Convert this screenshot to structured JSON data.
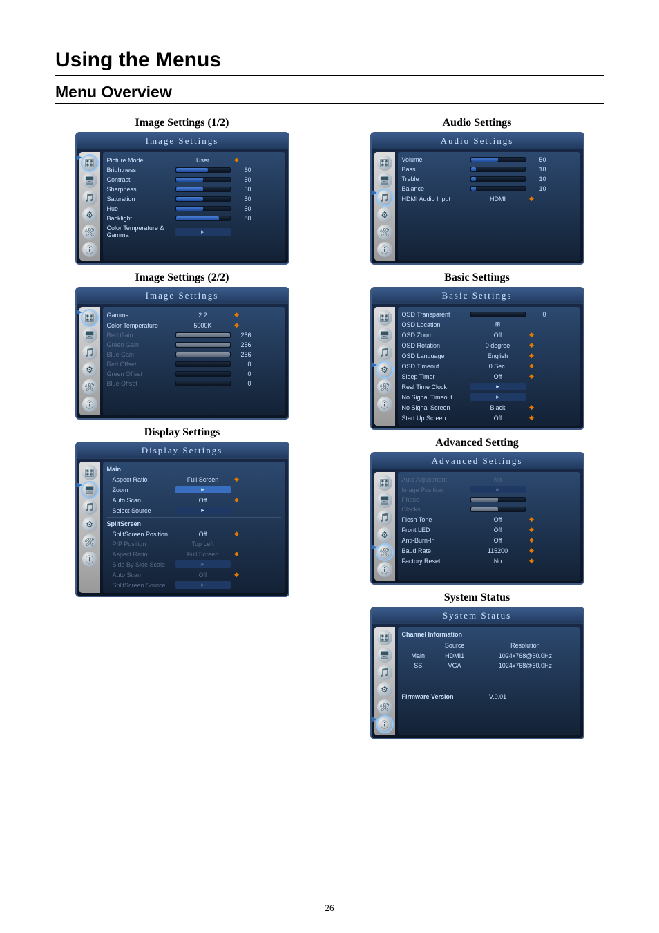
{
  "page_number": "26",
  "title": "Using the Menus",
  "subtitle": "Menu Overview",
  "panels": {
    "image1": {
      "title": "Image Settings (1/2)",
      "osd_title": "Image Settings",
      "rows": [
        {
          "label": "Picture Mode",
          "value": "User",
          "ind": "◆"
        },
        {
          "label": "Brightness",
          "slider": 60,
          "num": "60"
        },
        {
          "label": "Contrast",
          "slider": 50,
          "num": "50"
        },
        {
          "label": "Sharpness",
          "slider": 50,
          "num": "50"
        },
        {
          "label": "Saturation",
          "slider": 50,
          "num": "50"
        },
        {
          "label": "Hue",
          "slider": 50,
          "num": "50"
        },
        {
          "label": "Backlight",
          "slider": 80,
          "num": "80"
        },
        {
          "label": "Color Temperature & Gamma",
          "submenu": "▸"
        }
      ]
    },
    "image2": {
      "title": "Image Settings (2/2)",
      "osd_title": "Image Settings",
      "rows": [
        {
          "label": "Gamma",
          "value": "2.2",
          "ind": "◆"
        },
        {
          "label": "Color Temperature",
          "value": "5000K",
          "ind": "◆"
        },
        {
          "label": "Red Gain",
          "slider": 100,
          "gray": true,
          "dim": true,
          "num": "256"
        },
        {
          "label": "Green Gain",
          "slider": 100,
          "gray": true,
          "dim": true,
          "num": "256"
        },
        {
          "label": "Blue Gain",
          "slider": 100,
          "gray": true,
          "dim": true,
          "num": "256"
        },
        {
          "label": "Red Offset",
          "slider": 0,
          "gray": true,
          "dim": true,
          "num": "0"
        },
        {
          "label": "Green Offset",
          "slider": 0,
          "gray": true,
          "dim": true,
          "num": "0"
        },
        {
          "label": "Blue Offset",
          "slider": 0,
          "gray": true,
          "dim": true,
          "num": "0"
        }
      ]
    },
    "display": {
      "title": "Display Settings",
      "osd_title": "Display Settings",
      "section_main": "Main",
      "main_rows": [
        {
          "label": "Aspect Ratio",
          "value": "Full Screen",
          "ind": "◆"
        },
        {
          "label": "Zoom",
          "submenu": "▸",
          "hl": true
        },
        {
          "label": "Auto Scan",
          "value": "Off",
          "ind": "◆"
        },
        {
          "label": "Select Source",
          "submenu": "▸"
        }
      ],
      "section_split": "SplitScreen",
      "split_rows": [
        {
          "label": "SplitScreen Position",
          "value": "Off",
          "ind": "◆"
        },
        {
          "label": "PIP Position",
          "value": "Top Left",
          "dim": true
        },
        {
          "label": "Aspect Ratio",
          "value": "Full Screen",
          "ind": "◆",
          "dim": true
        },
        {
          "label": "Side By Side Scale",
          "submenu": "▸",
          "dim": true
        },
        {
          "label": "Auto Scan",
          "value": "Off",
          "ind": "◆",
          "dim": true
        },
        {
          "label": "SplitScreen Source",
          "submenu": "▸",
          "dim": true
        }
      ]
    },
    "audio": {
      "title": "Audio Settings",
      "osd_title": "Audio Settings",
      "rows": [
        {
          "label": "Volume",
          "slider": 50,
          "num": "50"
        },
        {
          "label": "Bass",
          "slider": 10,
          "num": "10"
        },
        {
          "label": "Treble",
          "slider": 10,
          "num": "10"
        },
        {
          "label": "Balance",
          "slider": 10,
          "num": "10"
        },
        {
          "label": "HDMI Audio Input",
          "value": "HDMI",
          "ind": "◆"
        }
      ]
    },
    "basic": {
      "title": "Basic Settings",
      "osd_title": "Basic Settings",
      "rows": [
        {
          "label": "OSD Transparent",
          "slider": 0,
          "num": "0"
        },
        {
          "label": "OSD Location",
          "value": "⊞"
        },
        {
          "label": "OSD Zoom",
          "value": "Off",
          "ind": "◆"
        },
        {
          "label": "OSD Rotation",
          "value": "0 degree",
          "ind": "◆"
        },
        {
          "label": "OSD Language",
          "value": "English",
          "ind": "◆"
        },
        {
          "label": "OSD Timeout",
          "value": "0    Sec.",
          "ind": "◆"
        },
        {
          "label": "Sleep Timer",
          "value": "Off",
          "ind": "◆"
        },
        {
          "label": "Real Time Clock",
          "submenu": "▸"
        },
        {
          "label": "No Signal Timeout",
          "submenu": "▸"
        },
        {
          "label": "No Signal Screen",
          "value": "Black",
          "ind": "◆"
        },
        {
          "label": "Start Up Screen",
          "value": "Off",
          "ind": "◆"
        }
      ]
    },
    "advanced": {
      "title": "Advanced Setting",
      "osd_title": "Advanced Settings",
      "rows": [
        {
          "label": "Auto Adjustment",
          "value": "No",
          "dim": true
        },
        {
          "label": "Image Position",
          "submenu": "▸",
          "dim": true
        },
        {
          "label": "Phase",
          "slider": 50,
          "dim": true,
          "gray": true
        },
        {
          "label": "Clocks",
          "slider": 50,
          "dim": true,
          "gray": true
        },
        {
          "label": "Flesh Tone",
          "value": "Off",
          "ind": "◆"
        },
        {
          "label": "Front LED",
          "value": "Off",
          "ind": "◆"
        },
        {
          "label": "Anti-Burn-In",
          "value": "Off",
          "ind": "◆"
        },
        {
          "label": "Baud Rate",
          "value": "115200",
          "ind": "◆"
        },
        {
          "label": "Factory Reset",
          "value": "No",
          "ind": "◆"
        }
      ]
    },
    "system": {
      "title": "System Status",
      "osd_title": "System Status",
      "channel_label": "Channel Information",
      "th_source": "Source",
      "th_res": "Resolution",
      "rows": [
        {
          "ch": "Main",
          "src": "HDMI1",
          "res": "1024x768@60.0Hz"
        },
        {
          "ch": "SS",
          "src": "VGA",
          "res": "1024x768@60.0Hz"
        }
      ],
      "fw_label": "Firmware Version",
      "fw_value": "V.0.01"
    }
  },
  "icons": [
    "sliders",
    "display",
    "audio",
    "gear",
    "tools",
    "info"
  ]
}
